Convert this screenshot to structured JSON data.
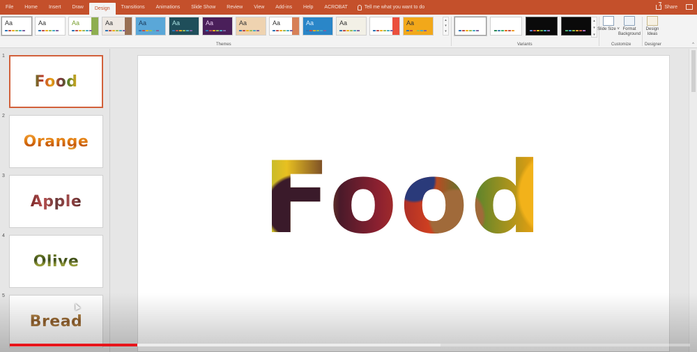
{
  "ribbon_tabs": [
    "File",
    "Home",
    "Insert",
    "Draw",
    "Design",
    "Transitions",
    "Animations",
    "Slide Show",
    "Review",
    "View",
    "Add-ins",
    "Help",
    "ACROBAT"
  ],
  "active_tab": "Design",
  "tell_me": "Tell me what you want to do",
  "share_label": "Share",
  "themes": {
    "label": "Themes",
    "items": [
      {
        "aa": "Aa",
        "bg": "#ffffff",
        "fg": "#333333",
        "selected": true
      },
      {
        "aa": "Aa",
        "bg": "#ffffff",
        "fg": "#333333"
      },
      {
        "aa": "Aa",
        "bg": "#ffffff",
        "fg": "#7aa030",
        "accent": "#7aa030"
      },
      {
        "aa": "Aa",
        "bg": "#eee8e2",
        "fg": "#333333",
        "accent": "#8a5a3a"
      },
      {
        "aa": "Aa",
        "bg": "#5aa7d8",
        "fg": "#1a3a5a"
      },
      {
        "aa": "Aa",
        "bg": "#1f4e5a",
        "fg": "#a8e0e0"
      },
      {
        "aa": "Aa",
        "bg": "#4a1f5a",
        "fg": "#e8c8f0"
      },
      {
        "aa": "Aa",
        "bg": "#efd3b0",
        "fg": "#333333"
      },
      {
        "aa": "Aa",
        "bg": "#ffffff",
        "fg": "#333333",
        "accent": "#d06a3a"
      },
      {
        "aa": "Aa",
        "bg": "#2a86c8",
        "fg": "#e0f0ff"
      },
      {
        "aa": "Aa",
        "bg": "#f2f0e6",
        "fg": "#333333"
      },
      {
        "aa": "Aa",
        "bg": "#ffffff",
        "fg": "#ffffff",
        "accent": "#e8301a"
      },
      {
        "aa": "Aa",
        "bg": "#f2a81a",
        "fg": "#333333"
      }
    ]
  },
  "variants": {
    "label": "Variants",
    "items": [
      {
        "dark": false,
        "selected": true
      },
      {
        "dark": false
      },
      {
        "dark": true
      },
      {
        "dark": true
      }
    ]
  },
  "customize": {
    "label": "Customize",
    "slide_size": "Slide Size ˅",
    "format_background": "Format Background"
  },
  "designer": {
    "label": "Designer",
    "design_ideas": "Design Ideas"
  },
  "slides": [
    {
      "number": "1",
      "text": "Food",
      "style": "tt-food",
      "selected": true
    },
    {
      "number": "2",
      "text": "Orange",
      "style": "tt-orange"
    },
    {
      "number": "3",
      "text": "Apple",
      "style": "tt-apple"
    },
    {
      "number": "4",
      "text": "Olive",
      "style": "tt-olive"
    },
    {
      "number": "5",
      "text": "Bread",
      "style": "tt-bread"
    }
  ],
  "current_slide": {
    "title": "Food"
  },
  "video_progress": {
    "played_fraction": 0.188,
    "buffered_fraction": 0.633
  },
  "colors": {
    "accent": "#c4502b",
    "progress_played": "#e8151b",
    "selected_thumb_border": "#d2603a"
  }
}
